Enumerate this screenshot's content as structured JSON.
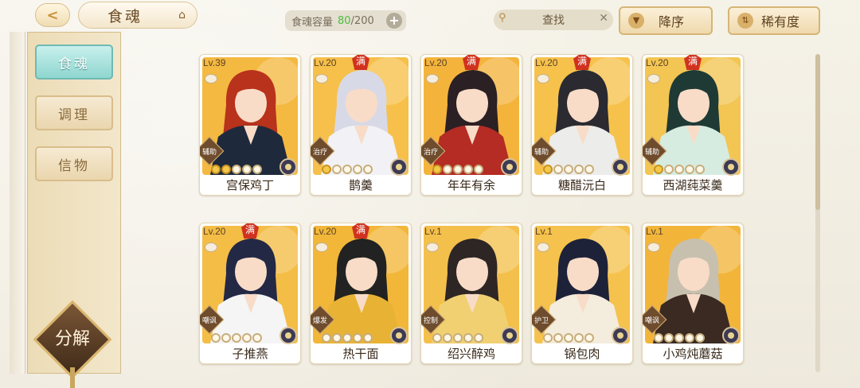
{
  "topbar": {
    "title": "食魂",
    "back_icon": "back-arrow-icon",
    "capacity_label": "食魂容量",
    "capacity_current": "80",
    "capacity_total": "/200",
    "plus": "+",
    "search_placeholder": "查找",
    "search_clear": "✕",
    "sort_order_label": "降序",
    "sort_key_label": "稀有度"
  },
  "sidebar": {
    "tabs": [
      {
        "label": "食魂",
        "active": true
      },
      {
        "label": "调理",
        "active": false
      },
      {
        "label": "信物",
        "active": false
      }
    ],
    "decompose_label": "分解"
  },
  "cards": [
    {
      "level": "Lv.39",
      "maxed": false,
      "role": "辅助",
      "stars_filled": 2,
      "stars_total": 5,
      "name": "宫保鸡丁",
      "bg": "#f4b940",
      "hair": "#b8321c",
      "coat": "#1e2a3c"
    },
    {
      "level": "Lv.20",
      "maxed": true,
      "role": "治疗",
      "stars_filled": 1,
      "stars_total": 5,
      "name": "鹊羹",
      "bg": "#f6c04a",
      "hair": "#d8d9e6",
      "coat": "#f2f2f6"
    },
    {
      "level": "Lv.20",
      "maxed": true,
      "role": "治疗",
      "stars_filled": 1,
      "stars_total": 5,
      "name": "年年有余",
      "bg": "#f4b43c",
      "hair": "#2b2023",
      "coat": "#b42c24"
    },
    {
      "level": "Lv.20",
      "maxed": true,
      "role": "辅助",
      "stars_filled": 1,
      "stars_total": 5,
      "name": "糖醋沅白",
      "bg": "#f6c24c",
      "hair": "#2a2a30",
      "coat": "#ececea"
    },
    {
      "level": "Lv.20",
      "maxed": true,
      "role": "辅助",
      "stars_filled": 1,
      "stars_total": 5,
      "name": "西湖莼菜羹",
      "bg": "#f3c552",
      "hair": "#1f3a35",
      "coat": "#d7ece0"
    },
    {
      "level": "Lv.20",
      "maxed": true,
      "role": "嘲讽",
      "stars_filled": 0,
      "stars_total": 5,
      "name": "子推燕",
      "bg": "#f4bd46",
      "hair": "#232845",
      "coat": "#f5f5f5"
    },
    {
      "level": "Lv.20",
      "maxed": true,
      "role": "爆发",
      "stars_filled": 0,
      "stars_total": 5,
      "name": "热干面",
      "bg": "#f2b738",
      "hair": "#222222",
      "coat": "#e8b334"
    },
    {
      "level": "Lv.1",
      "maxed": false,
      "role": "控制",
      "stars_filled": 0,
      "stars_total": 5,
      "name": "绍兴醉鸡",
      "bg": "#f4c04c",
      "hair": "#2e2624",
      "coat": "#f0d070"
    },
    {
      "level": "Lv.1",
      "maxed": false,
      "role": "护卫",
      "stars_filled": 0,
      "stars_total": 5,
      "name": "锅包肉",
      "bg": "#f5c24e",
      "hair": "#1e2238",
      "coat": "#f4ecdc"
    },
    {
      "level": "Lv.1",
      "maxed": false,
      "role": "嘲讽",
      "stars_filled": 0,
      "stars_total": 5,
      "name": "小鸡炖蘑菇",
      "bg": "#f2b53a",
      "hair": "#c8c0ae",
      "coat": "#3a2a22"
    }
  ],
  "maxed_badge": "满"
}
